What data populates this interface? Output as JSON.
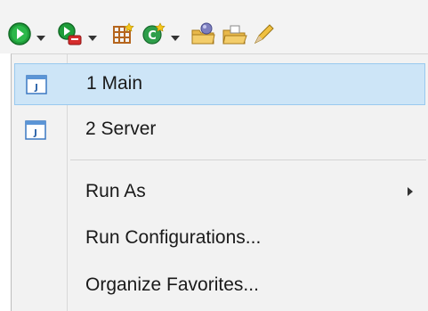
{
  "toolbar": {
    "icons": [
      {
        "name": "run-icon",
        "has_dropdown": true
      },
      {
        "name": "debug-external-tools-icon",
        "has_dropdown": true
      },
      {
        "name": "new-class-icon",
        "has_dropdown": false
      },
      {
        "name": "new-java-element-icon",
        "has_dropdown": true
      },
      {
        "name": "open-type-icon",
        "has_dropdown": false
      },
      {
        "name": "open-task-icon",
        "has_dropdown": false
      },
      {
        "name": "pencil-icon",
        "has_dropdown": false
      }
    ]
  },
  "menu": {
    "recent": [
      {
        "label": "1 Main",
        "icon": "java-launch-icon",
        "highlighted": true
      },
      {
        "label": "2 Server",
        "icon": "java-launch-icon",
        "highlighted": false
      }
    ],
    "actions": [
      {
        "label": "Run As",
        "has_submenu": true
      },
      {
        "label": "Run Configurations...",
        "has_submenu": false
      },
      {
        "label": "Organize Favorites...",
        "has_submenu": false
      }
    ]
  },
  "colors": {
    "highlight_bg": "#cde5f7",
    "highlight_border": "#99c9ef",
    "run_green": "#1f9d3a"
  }
}
